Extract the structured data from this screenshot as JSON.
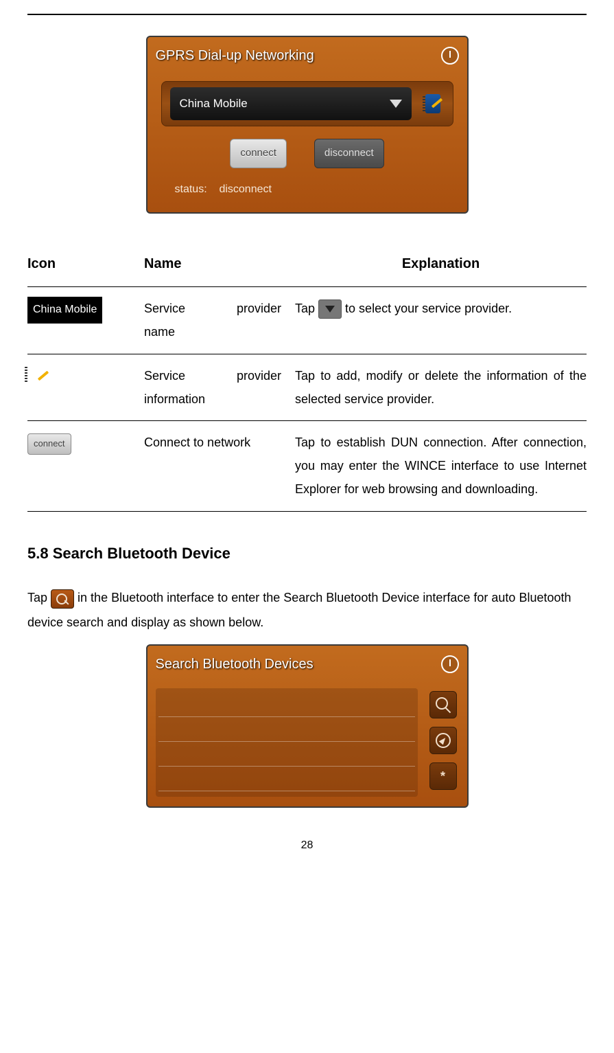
{
  "gprs": {
    "title": "GPRS Dial-up Networking",
    "provider_selected": "China Mobile",
    "connect_label": "connect",
    "disconnect_label": "disconnect",
    "status_label": "status:",
    "status_value": "disconnect"
  },
  "table": {
    "head_icon": "Icon",
    "head_name": "Name",
    "head_expl": "Explanation",
    "rows": [
      {
        "icon_label": "China Mobile",
        "name_a": "Service",
        "name_b": "provider",
        "name_line2": "name",
        "expl_prefix": "Tap ",
        "expl_suffix": " to select your service provider."
      },
      {
        "name_a": "Service",
        "name_b": "provider",
        "name_line2": "information",
        "expl": "Tap to add, modify or delete the information of the selected service provider."
      },
      {
        "icon_label": "connect",
        "name": "Connect to network",
        "expl": "Tap to establish DUN connection. After connection, you may enter the WINCE interface to use Internet Explorer for web browsing and downloading."
      }
    ]
  },
  "section_heading": "5.8 Search Bluetooth Device",
  "bt_para_prefix": "Tap ",
  "bt_para_suffix": " in the Bluetooth interface to enter the Search Bluetooth Device interface for auto Bluetooth device search and display as shown below.",
  "bt_window_title": "Search Bluetooth Devices",
  "bt_side_glyph": "*",
  "page_number": "28"
}
